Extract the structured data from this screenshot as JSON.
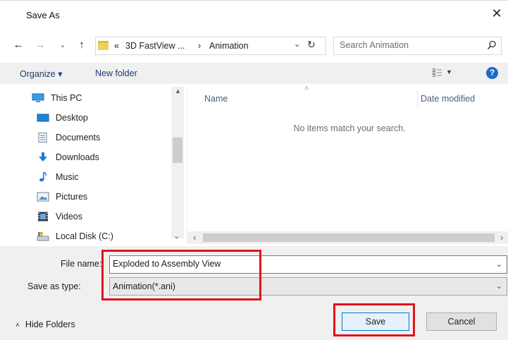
{
  "window": {
    "title": "Save As",
    "close_glyph": "✕"
  },
  "nav": {
    "back_glyph": "←",
    "forward_glyph": "→",
    "recent_glyph": "⌄",
    "up_glyph": "↑",
    "breadcrumb_prefix": "«",
    "breadcrumb": [
      "3D FastView ...",
      "Animation"
    ],
    "breadcrumb_sep": "›",
    "address_dropdown_glyph": "⌄",
    "refresh_glyph": "↻",
    "search_placeholder": "Search Animation"
  },
  "toolbar": {
    "organize_label": "Organize ▾",
    "new_folder_label": "New folder",
    "views_dropdown_glyph": "▼",
    "help_glyph": "?"
  },
  "sidebar": {
    "items": [
      {
        "label": "This PC",
        "icon": "computer-icon"
      },
      {
        "label": "Desktop",
        "icon": "desktop-icon"
      },
      {
        "label": "Documents",
        "icon": "documents-icon"
      },
      {
        "label": "Downloads",
        "icon": "downloads-icon"
      },
      {
        "label": "Music",
        "icon": "music-icon"
      },
      {
        "label": "Pictures",
        "icon": "pictures-icon"
      },
      {
        "label": "Videos",
        "icon": "videos-icon"
      },
      {
        "label": "Local Disk (C:)",
        "icon": "local-disk-icon"
      }
    ],
    "scroll_up_glyph": "▲",
    "scroll_down_glyph": "⌄"
  },
  "filelist": {
    "columns": [
      "Name",
      "Date modified"
    ],
    "sort_glyph": "˄",
    "empty_message": "No items match your search.",
    "scroll_left_glyph": "‹",
    "scroll_right_glyph": "›"
  },
  "form": {
    "file_name_label": "File name:",
    "file_name_value": "Exploded to Assembly View",
    "save_as_type_label": "Save as type:",
    "save_as_type_value": "Animation(*.ani)",
    "dropdown_glyph": "⌄"
  },
  "footer": {
    "hide_folders_label": "Hide Folders",
    "hide_folders_glyph": "˄",
    "save_label": "Save",
    "cancel_label": "Cancel"
  },
  "colors": {
    "accent": "#0078d7",
    "highlight": "#e0141e",
    "folder": "#f3cf5d",
    "help": "#1c6ac8"
  }
}
